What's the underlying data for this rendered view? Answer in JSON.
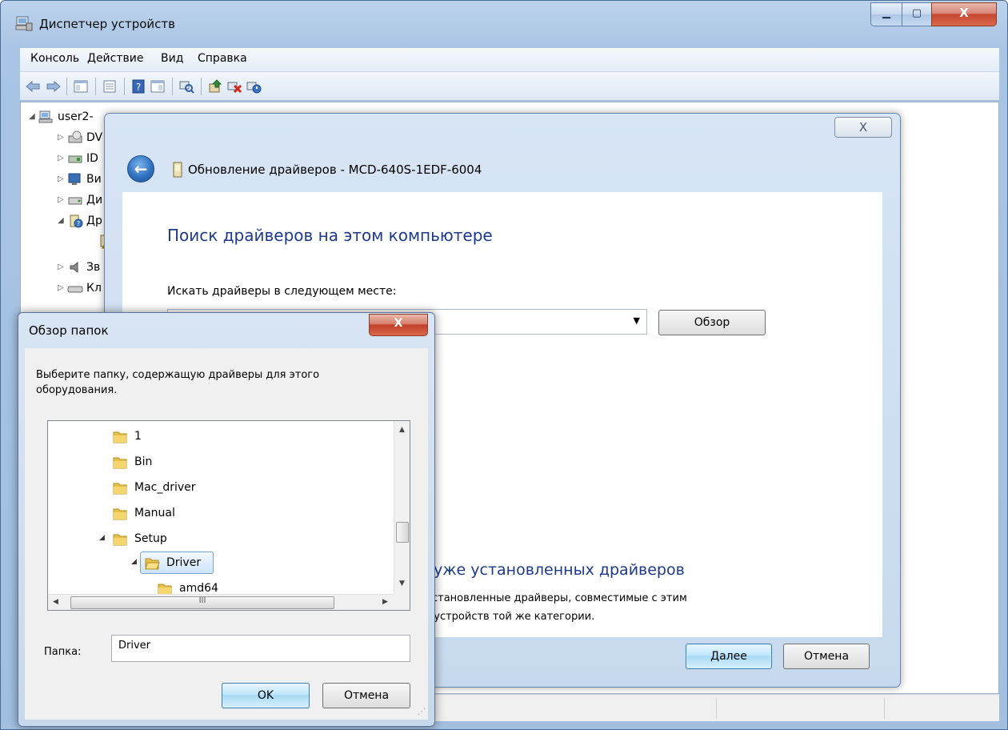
{
  "device_manager": {
    "title": "Диспетчер устройств",
    "buttons": {
      "minimize": "▁",
      "maximize": "▢",
      "close": "X"
    },
    "menu": [
      "Консоль",
      "Действие",
      "Вид",
      "Справка"
    ],
    "tree": [
      {
        "label": "user2-",
        "icon": "computer-icon"
      },
      {
        "label": "DV",
        "icon": "dvd-drive-icon"
      },
      {
        "label": "ID",
        "icon": "ide-controller-icon"
      },
      {
        "label": "Ви",
        "icon": "display-adapter-icon"
      },
      {
        "label": "Ди",
        "icon": "disk-drive-icon"
      },
      {
        "label": "Др",
        "icon": "other-devices-icon"
      },
      {
        "label": "Зв",
        "icon": "sound-icon"
      },
      {
        "label": "Кл",
        "icon": "keyboard-icon"
      }
    ]
  },
  "update_dialog": {
    "close_label": "X",
    "title": "Обновление драйверов - MCD-640S-1EDF-6004",
    "heading": "Поиск драйверов на этом компьютере",
    "search_label": "Искать драйверы в следующем месте:",
    "browse_button": "Обзор",
    "pick_title": "ка уже установленных драйверов",
    "pick_desc_line1": "се установленные драйверы, совместимые с этим",
    "pick_desc_line2": "для устройств той же категории.",
    "next_button": "Далее",
    "cancel_button": "Отмена"
  },
  "browse_dialog": {
    "title": "Обзор папок",
    "close_label": "X",
    "description": "Выберите папку, содержащую драйверы для этого оборудования.",
    "folders": [
      {
        "label": "1"
      },
      {
        "label": "Bin"
      },
      {
        "label": "Mac_driver"
      },
      {
        "label": "Manual"
      },
      {
        "label": "Setup"
      },
      {
        "label": "Driver"
      },
      {
        "label": "amd64"
      }
    ],
    "scroll_grip": "III",
    "folder_label": "Папка:",
    "folder_value": "Driver",
    "ok_button": "OK",
    "cancel_button": "Отмена"
  },
  "colors": {
    "window_frame": "#a9c4e4",
    "link_blue": "#1c3a89",
    "selection": "#cde4fa",
    "folder_yellow": "#e8c04a"
  }
}
